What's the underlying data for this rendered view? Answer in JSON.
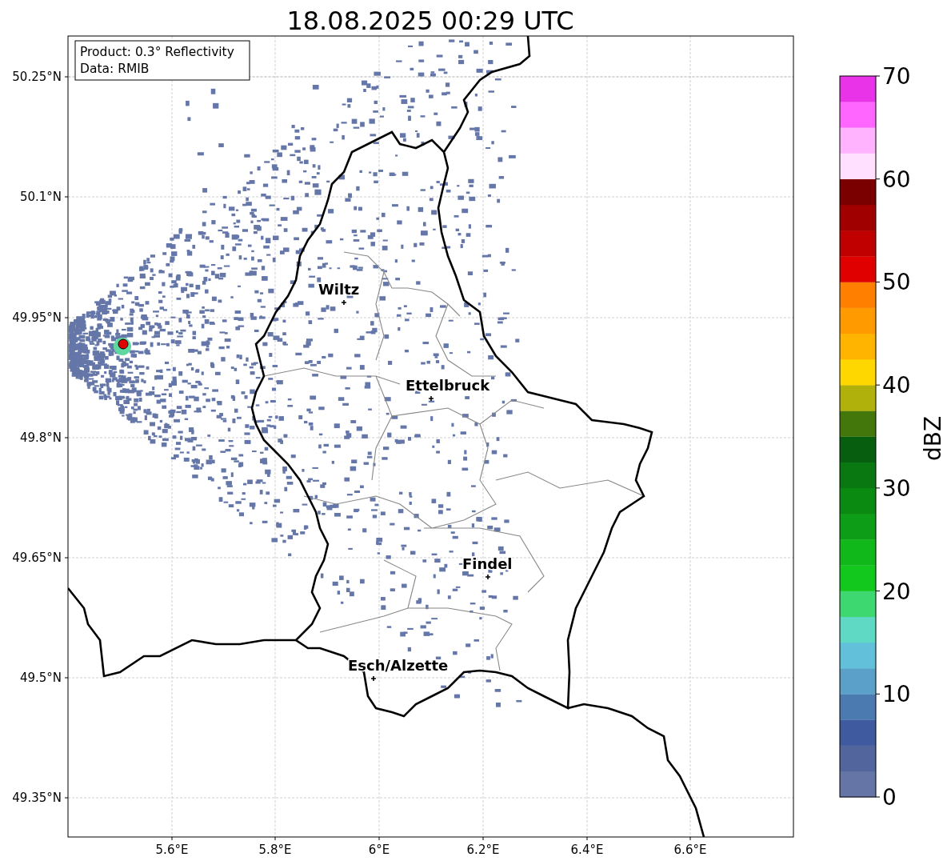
{
  "title": "18.08.2025 00:29 UTC",
  "legend": [
    "Product: 0.3° Reflectivity",
    "Data: RMIB"
  ],
  "x_tick_labels": [
    "5.6°E",
    "5.8°E",
    "6°E",
    "6.2°E",
    "6.4°E",
    "6.6°E"
  ],
  "y_tick_labels": [
    "50.25°N",
    "50.1°N",
    "49.95°N",
    "49.8°N",
    "49.65°N",
    "49.5°N",
    "49.35°N"
  ],
  "cities": [
    {
      "name": "Wiltz"
    },
    {
      "name": "Ettelbruck"
    },
    {
      "name": "Findel"
    },
    {
      "name": "Esch/Alzette"
    }
  ],
  "colorbar": {
    "label": "dBZ",
    "ticks": [
      "70",
      "60",
      "50",
      "40",
      "30",
      "20",
      "10",
      "0"
    ],
    "bands": [
      {
        "color": "#6575a5"
      },
      {
        "color": "#52659d"
      },
      {
        "color": "#3f5a9e"
      },
      {
        "color": "#4a7ab0"
      },
      {
        "color": "#5aa0c8"
      },
      {
        "color": "#62c0db"
      },
      {
        "color": "#5fd8c4"
      },
      {
        "color": "#3ed870"
      },
      {
        "color": "#12c81c"
      },
      {
        "color": "#10b81a"
      },
      {
        "color": "#0e9d16"
      },
      {
        "color": "#0b8a12"
      },
      {
        "color": "#0a7810"
      },
      {
        "color": "#075e0e"
      },
      {
        "color": "#43770c"
      },
      {
        "color": "#b0b10a"
      },
      {
        "color": "#ffd700"
      },
      {
        "color": "#ffb400"
      },
      {
        "color": "#ff9a00"
      },
      {
        "color": "#ff8000"
      },
      {
        "color": "#e00000"
      },
      {
        "color": "#c00000"
      },
      {
        "color": "#a00000"
      },
      {
        "color": "#7a0000"
      },
      {
        "color": "#ffe0ff"
      },
      {
        "color": "#ffb3ff"
      },
      {
        "color": "#ff66ff"
      },
      {
        "color": "#e833e8"
      }
    ]
  }
}
